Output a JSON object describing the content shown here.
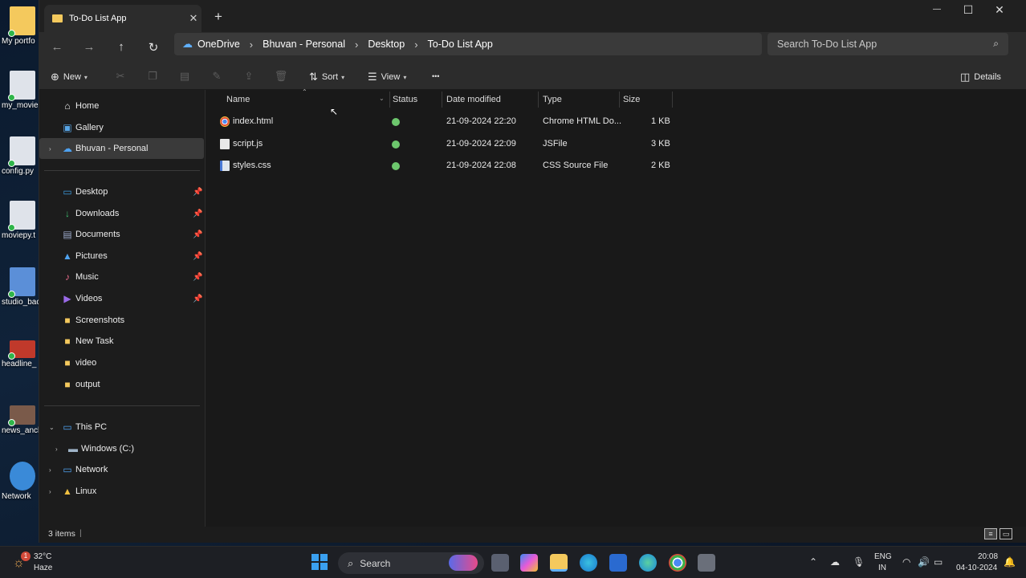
{
  "desktop_icons": [
    {
      "label": "My portfo",
      "color": "#f4c95d"
    },
    {
      "label": "my_movie",
      "color": "#dfe3ea"
    },
    {
      "label": "config.py",
      "color": "#dfe3ea"
    },
    {
      "label": "moviepy.t",
      "color": "#dfe3ea"
    },
    {
      "label": "studio_bac",
      "color": "#5b8fd8"
    },
    {
      "label": "headline_",
      "color": "#c0392b"
    },
    {
      "label": "news_anch",
      "color": "#7a5a4a"
    },
    {
      "label": "Network",
      "color": "#3a8ad8"
    }
  ],
  "window": {
    "tab_title": "To-Do List App",
    "close_glyph": "✕",
    "new_tab_glyph": "+",
    "min_glyph": "—",
    "max_glyph": "☐",
    "wclose_glyph": "✕"
  },
  "nav": {
    "back_glyph": "←",
    "forward_glyph": "→",
    "up_glyph": "↑",
    "refresh_glyph": "↻",
    "breadcrumb": [
      "OneDrive",
      "Bhuvan - Personal",
      "Desktop",
      "To-Do List App"
    ],
    "search_placeholder": "Search To-Do List App"
  },
  "commandbar": {
    "new_label": "New",
    "sort_label": "Sort",
    "view_label": "View",
    "more_glyph": "•••",
    "details_label": "Details"
  },
  "sidebar": {
    "home": "Home",
    "gallery": "Gallery",
    "onedrive": "Bhuvan - Personal",
    "quick": [
      {
        "label": "Desktop",
        "pinned": true
      },
      {
        "label": "Downloads",
        "pinned": true
      },
      {
        "label": "Documents",
        "pinned": true
      },
      {
        "label": "Pictures",
        "pinned": true
      },
      {
        "label": "Music",
        "pinned": true
      },
      {
        "label": "Videos",
        "pinned": true
      },
      {
        "label": "Screenshots",
        "pinned": false
      },
      {
        "label": "New Task",
        "pinned": false
      },
      {
        "label": "video",
        "pinned": false
      },
      {
        "label": "output",
        "pinned": false
      }
    ],
    "this_pc": "This PC",
    "windows_c": "Windows (C:)",
    "network": "Network",
    "linux": "Linux"
  },
  "columns": {
    "name": "Name",
    "status": "Status",
    "date": "Date modified",
    "type": "Type",
    "size": "Size"
  },
  "files": [
    {
      "name": "index.html",
      "date": "21-09-2024 22:20",
      "type": "Chrome HTML Do...",
      "size": "1 KB",
      "icon": "chrome-icon"
    },
    {
      "name": "script.js",
      "date": "21-09-2024 22:09",
      "type": "JSFile",
      "size": "3 KB",
      "icon": "js-file-icon"
    },
    {
      "name": "styles.css",
      "date": "21-09-2024 22:08",
      "type": "CSS Source File",
      "size": "2 KB",
      "icon": "css-file-icon"
    }
  ],
  "status_bar": {
    "item_count": "3 items"
  },
  "taskbar": {
    "temp": "32°C",
    "weather": "Haze",
    "weather_badge": "1",
    "search_label": "Search",
    "lang_top": "ENG",
    "lang_bottom": "IN",
    "time": "20:08",
    "date": "04-10-2024"
  }
}
